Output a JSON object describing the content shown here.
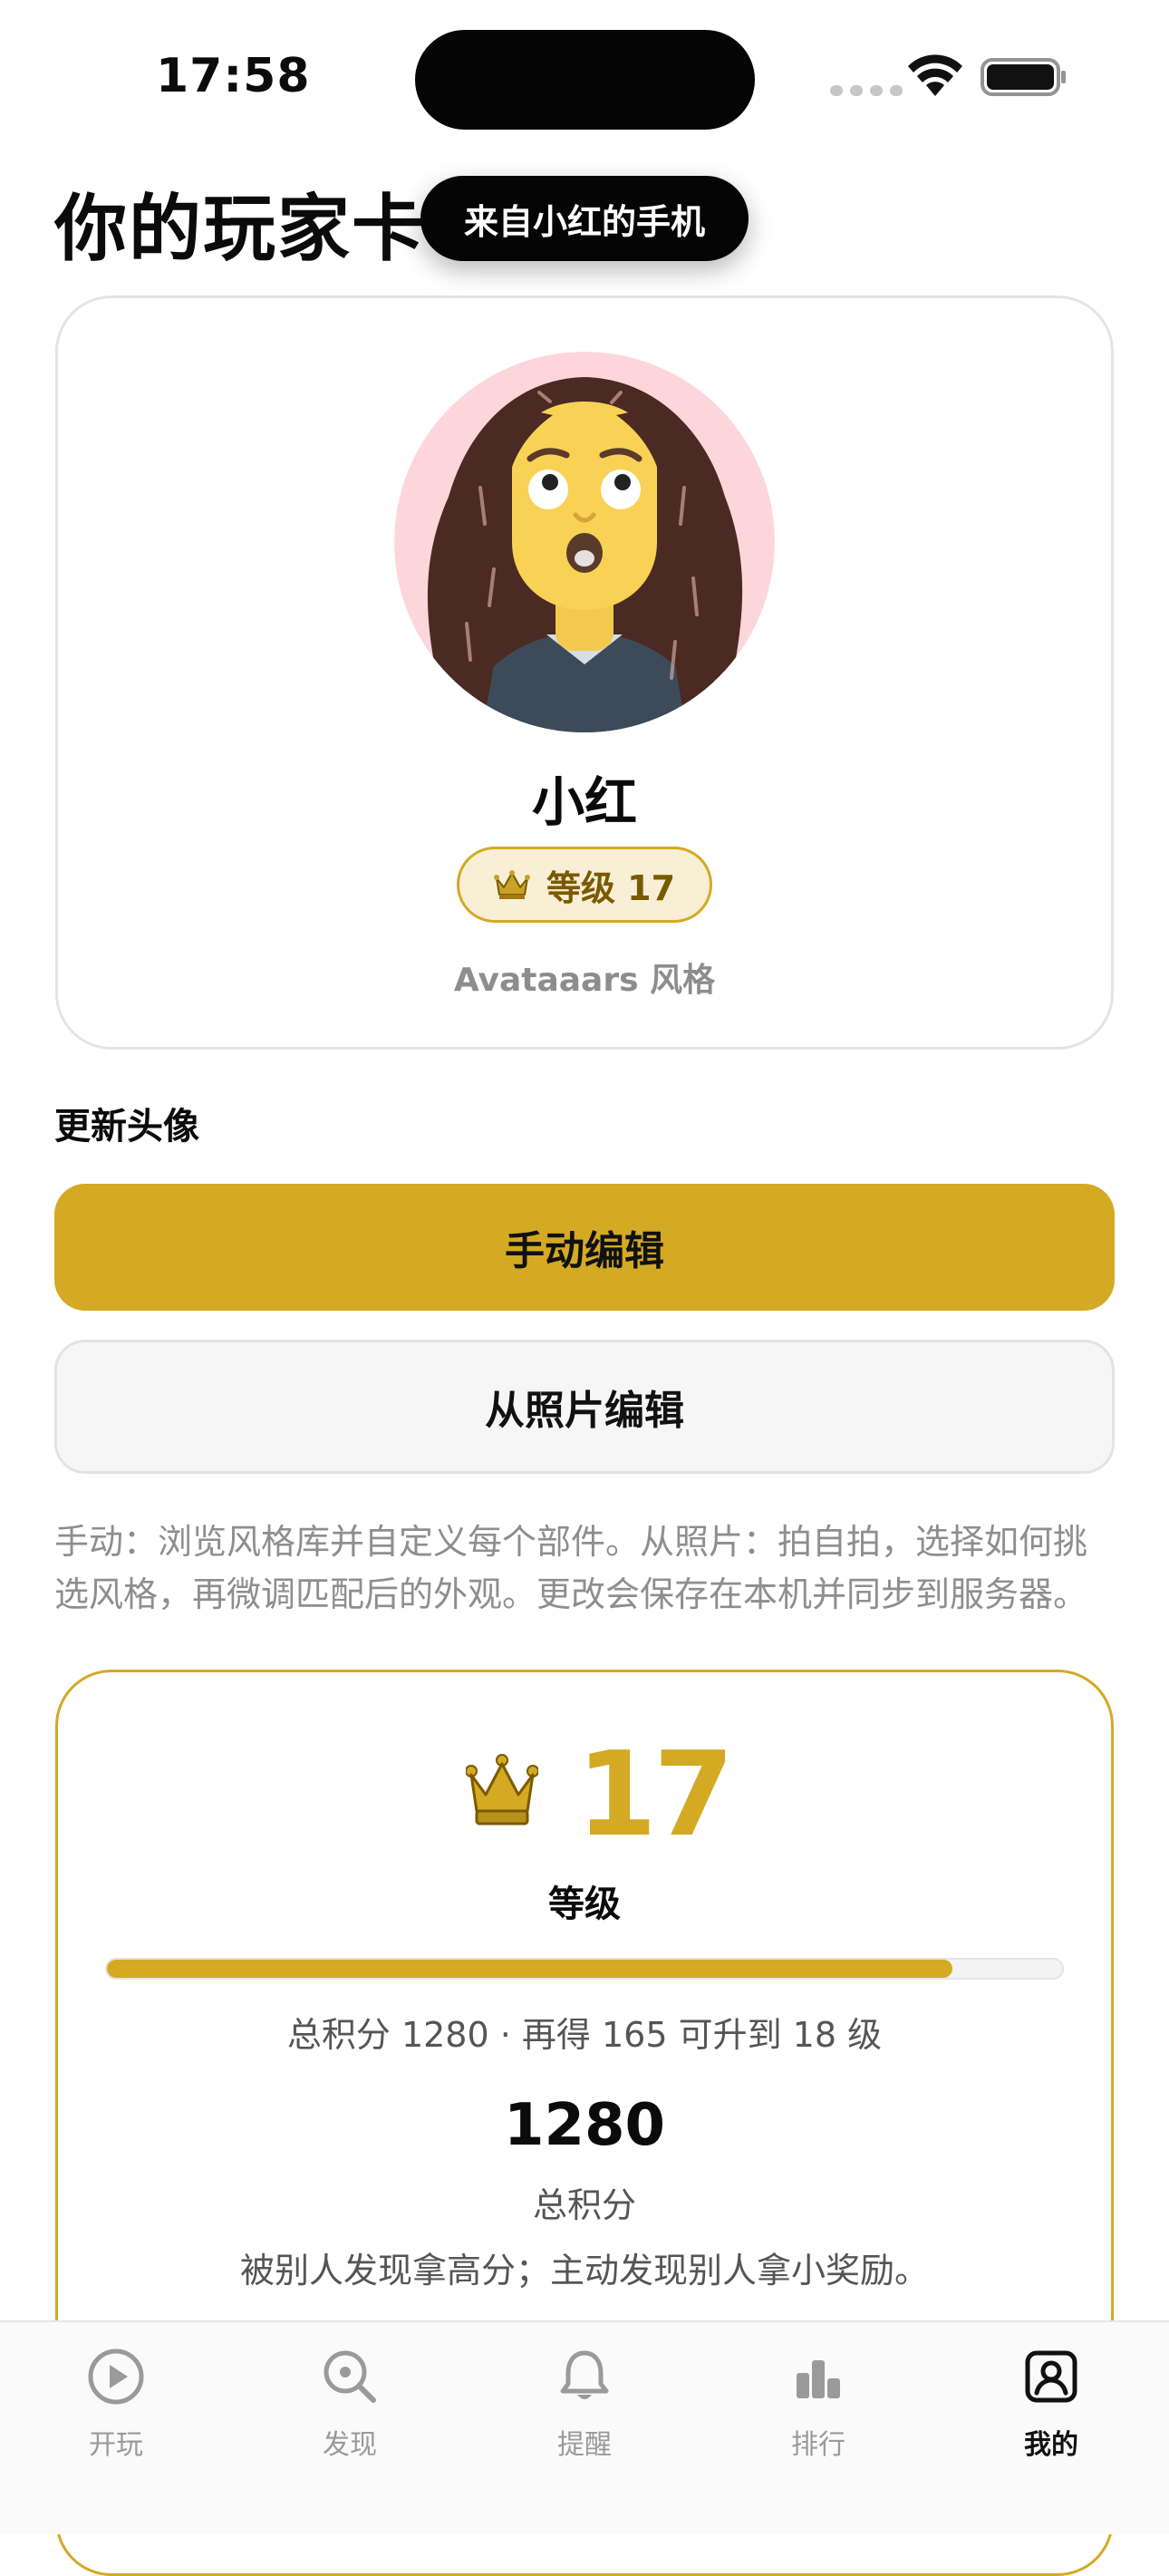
{
  "status_bar": {
    "time": "17:58"
  },
  "header": {
    "title": "你的玩家卡",
    "device_badge": "来自小红的手机"
  },
  "player_card": {
    "name": "小红",
    "level_label": "等级 17",
    "style": "Avataaars 风格",
    "avatar_bg_color": "#fdd6dc"
  },
  "update_section": {
    "heading": "更新头像",
    "manual_button": "手动编辑",
    "photo_button": "从照片编辑",
    "help_text": "手动：浏览风格库并自定义每个部件。从照片：拍自拍，选择如何挑选风格，再微调匹配后的外观。更改会保存在本机并同步到服务器。"
  },
  "level_card": {
    "level": "17",
    "level_caption": "等级",
    "progress_fraction": 0.885,
    "progress_text": "总积分 1280 · 再得 165 可升到 18 级",
    "points": "1280",
    "points_caption": "总积分",
    "points_note": "被别人发现拿高分；主动发现别人拿小奖励。"
  },
  "tabs": [
    {
      "label": "开玩",
      "icon": "play-circle-icon",
      "active": false
    },
    {
      "label": "发现",
      "icon": "search-icon",
      "active": false
    },
    {
      "label": "提醒",
      "icon": "bell-icon",
      "active": false
    },
    {
      "label": "排行",
      "icon": "bar-chart-icon",
      "active": false
    },
    {
      "label": "我的",
      "icon": "profile-icon",
      "active": true
    }
  ],
  "colors": {
    "accent": "#d4a924",
    "accent_light": "#f8efd6",
    "text_muted": "#8e8e8e"
  }
}
